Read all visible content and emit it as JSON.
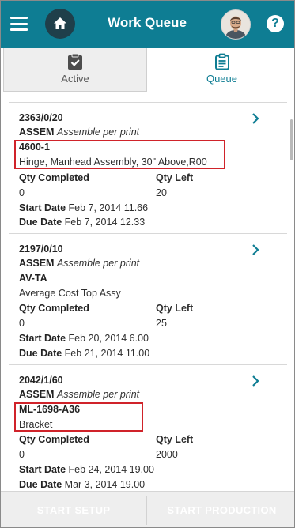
{
  "header": {
    "title": "Work Queue",
    "help_label": "?"
  },
  "tabs": [
    {
      "label": "Active"
    },
    {
      "label": "Queue"
    }
  ],
  "labels": {
    "qty_completed": "Qty Completed",
    "qty_left": "Qty Left",
    "start_date": "Start Date",
    "due_date": "Due Date"
  },
  "jobs": [
    {
      "job": "2363/0/20",
      "operation": "ASSEM",
      "operation_desc": "Assemble per print",
      "part": "4600-1",
      "part_desc": "Hinge, Manhead Assembly, 30\" Above,R00",
      "qty_completed": "0",
      "qty_left": "20",
      "start_date": "Feb 7, 2014 11.66",
      "due_date": "Feb 7, 2014 12.33"
    },
    {
      "job": "2197/0/10",
      "operation": "ASSEM",
      "operation_desc": "Assemble per print",
      "part": "AV-TA",
      "part_desc": "Average Cost Top Assy",
      "qty_completed": "0",
      "qty_left": "25",
      "start_date": "Feb 20, 2014 6.00",
      "due_date": "Feb 21, 2014 11.00"
    },
    {
      "job": "2042/1/60",
      "operation": "ASSEM",
      "operation_desc": "Assemble per print",
      "part": "ML-1698-A36",
      "part_desc": "Bracket",
      "qty_completed": "0",
      "qty_left": "2000",
      "start_date": "Feb 24, 2014 19.00",
      "due_date": "Mar 3, 2014 19.00"
    }
  ],
  "footer": {
    "start_setup": "START SETUP",
    "start_production": "START PRODUCTION"
  },
  "colors": {
    "header": "#0e7d93",
    "accent": "#0e7d93",
    "highlight": "#d0232a"
  }
}
